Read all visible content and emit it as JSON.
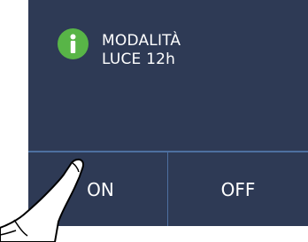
{
  "notification": {
    "icon": "info-icon",
    "line1": "MODALITÀ",
    "line2": "LUCE 12h"
  },
  "buttons": {
    "on_label": "ON",
    "off_label": "OFF"
  },
  "colors": {
    "panel_bg": "#2e3a55",
    "divider": "#4d6fa0",
    "info_icon": "#58b547",
    "text": "#ffffff"
  }
}
